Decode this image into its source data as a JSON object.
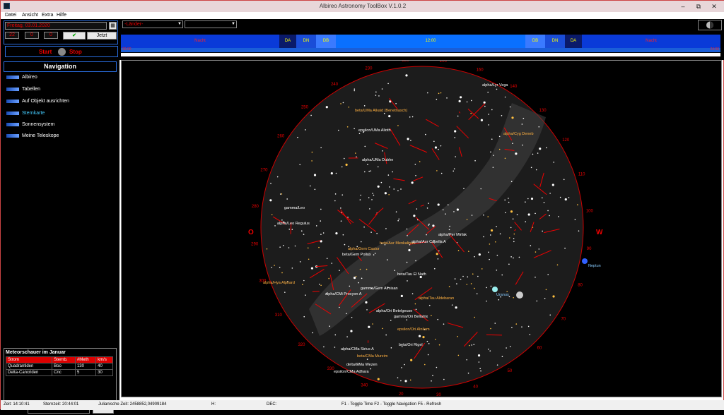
{
  "window": {
    "title": "Albireo Astronomy ToolBox V.1.0.2",
    "minimize": "–",
    "maximize": "⧉",
    "close": "✕"
  },
  "menu": [
    "Datei",
    "Ansicht",
    "Extra",
    "Hilfe"
  ],
  "controls": {
    "date": "Freitag, 03.01.2020",
    "hour": "22",
    "minute": "0",
    "second": "0",
    "now_label": "Jetzt",
    "start_label": "Start",
    "stop_label": "Stop",
    "country_placeholder": "-Länder-",
    "city_value": ""
  },
  "navigation": {
    "title": "Navigation",
    "items": [
      "Albireo",
      "Tabellen",
      "Auf Objekt ausrichten",
      "Sternkarte",
      "Sonnensystem",
      "Meine Teleskope"
    ],
    "active_index": 3
  },
  "meteor": {
    "title": "Meteorschauer im Januar",
    "headers": [
      "Strom",
      "Sternb.",
      "Max",
      "#Meth",
      "km/s"
    ],
    "rows": [
      [
        "Quadrantiden",
        "Boo",
        "",
        "130",
        "40"
      ],
      [
        "Delta-Cancriden",
        "Cnc",
        "",
        "5",
        "30"
      ]
    ]
  },
  "search": {
    "label": "Suche",
    "value": "",
    "clear_label": "Clear"
  },
  "timeline": {
    "left_label": "Nacht",
    "right_label": "Nacht",
    "center_label": "12:00",
    "da": "DA",
    "dn": "DN",
    "db": "DB",
    "ruler_left": "00:00",
    "ruler_right": "24:00"
  },
  "sky": {
    "compass": {
      "west": "W",
      "east": "O"
    },
    "azimuth_labels": [
      "160",
      "140",
      "130",
      "120",
      "110",
      "100",
      "90",
      "80",
      "70",
      "60",
      "50",
      "40",
      "30",
      "20",
      "340",
      "330",
      "320",
      "310",
      "300",
      "290",
      "280",
      "270",
      "260",
      "250",
      "240",
      "230",
      "220",
      "200"
    ],
    "stars": [
      "alpha/Lyr Vega",
      "beta/UMa Alkaid (Benetnasch)",
      "epsilon/UMa Alioth",
      "alpha/UMa Dubhe",
      "alpha/Cyg Deneb",
      "gamma/Leo",
      "alpha/Leo Regulus",
      "beta/Aur Menkalinan",
      "alpha/Aur Capella A",
      "alpha/Per Mirfak",
      "alpha/Gem Castor",
      "beta/Gem Pollux",
      "beta/Tau El Nath",
      "alpha/Hya Alphard",
      "gamma/Gem Almisan",
      "alpha/CMi Procyon A",
      "alpha/Tau Aldebaran",
      "alpha/Ori Betelgeuse",
      "gamma/Ori Bellatrix",
      "epsilon/Ori Alnilam",
      "beta/Ori Rigel",
      "alpha/CMa Sirius A",
      "beta/CMa Murzim",
      "delta/CMa Wezen",
      "epsilon/CMa Adhara"
    ],
    "planets": [
      "Neptun",
      "Uranus"
    ]
  },
  "status": {
    "zeit": "Zeit: 14:10:41",
    "sternzeit": "Sternzeit: 20:44:01",
    "julian": "Julianische Zeit: 2458852,04909184",
    "h": "H:",
    "dec": "DEC:",
    "keys": "F1 - Toggle Time    F2 - Toggle Navigation    F5 - Refresh"
  },
  "colors": {
    "accent": "#2a6ee0",
    "red": "#e00000",
    "yellow": "#ffd000"
  }
}
